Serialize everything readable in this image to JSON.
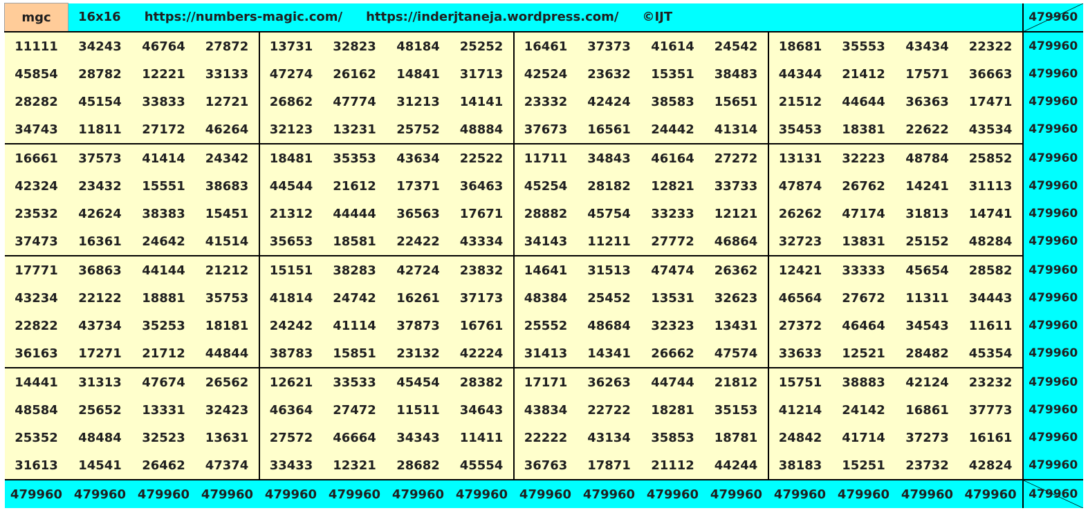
{
  "header": {
    "label": "mgc",
    "order": "16x16",
    "site1": "https://numbers-magic.com/",
    "site2": "https://inderjtaneja.wordpress.com/",
    "copyright": "©IJT",
    "corner_sum": "479960"
  },
  "grid": [
    [
      "11111",
      "34243",
      "46764",
      "27872",
      "13731",
      "32823",
      "48184",
      "25252",
      "16461",
      "37373",
      "41614",
      "24542",
      "18681",
      "35553",
      "43434",
      "22322"
    ],
    [
      "45854",
      "28782",
      "12221",
      "33133",
      "47274",
      "26162",
      "14841",
      "31713",
      "42524",
      "23632",
      "15351",
      "38483",
      "44344",
      "21412",
      "17571",
      "36663"
    ],
    [
      "28282",
      "45154",
      "33833",
      "12721",
      "26862",
      "47774",
      "31213",
      "14141",
      "23332",
      "42424",
      "38583",
      "15651",
      "21512",
      "44644",
      "36363",
      "17471"
    ],
    [
      "34743",
      "11811",
      "27172",
      "46264",
      "32123",
      "13231",
      "25752",
      "48884",
      "37673",
      "16561",
      "24442",
      "41314",
      "35453",
      "18381",
      "22622",
      "43534"
    ],
    [
      "16661",
      "37573",
      "41414",
      "24342",
      "18481",
      "35353",
      "43634",
      "22522",
      "11711",
      "34843",
      "46164",
      "27272",
      "13131",
      "32223",
      "48784",
      "25852"
    ],
    [
      "42324",
      "23432",
      "15551",
      "38683",
      "44544",
      "21612",
      "17371",
      "36463",
      "45254",
      "28182",
      "12821",
      "33733",
      "47874",
      "26762",
      "14241",
      "31113"
    ],
    [
      "23532",
      "42624",
      "38383",
      "15451",
      "21312",
      "44444",
      "36563",
      "17671",
      "28882",
      "45754",
      "33233",
      "12121",
      "26262",
      "47174",
      "31813",
      "14741"
    ],
    [
      "37473",
      "16361",
      "24642",
      "41514",
      "35653",
      "18581",
      "22422",
      "43334",
      "34143",
      "11211",
      "27772",
      "46864",
      "32723",
      "13831",
      "25152",
      "48284"
    ],
    [
      "17771",
      "36863",
      "44144",
      "21212",
      "15151",
      "38283",
      "42724",
      "23832",
      "14641",
      "31513",
      "47474",
      "26362",
      "12421",
      "33333",
      "45654",
      "28582"
    ],
    [
      "43234",
      "22122",
      "18881",
      "35753",
      "41814",
      "24742",
      "16261",
      "37173",
      "48384",
      "25452",
      "13531",
      "32623",
      "46564",
      "27672",
      "11311",
      "34443"
    ],
    [
      "22822",
      "43734",
      "35253",
      "18181",
      "24242",
      "41114",
      "37873",
      "16761",
      "25552",
      "48684",
      "32323",
      "13431",
      "27372",
      "46464",
      "34543",
      "11611"
    ],
    [
      "36163",
      "17271",
      "21712",
      "44844",
      "38783",
      "15851",
      "23132",
      "42224",
      "31413",
      "14341",
      "26662",
      "47574",
      "33633",
      "12521",
      "28482",
      "45354"
    ],
    [
      "14441",
      "31313",
      "47674",
      "26562",
      "12621",
      "33533",
      "45454",
      "28382",
      "17171",
      "36263",
      "44744",
      "21812",
      "15751",
      "38883",
      "42124",
      "23232"
    ],
    [
      "48584",
      "25652",
      "13331",
      "32423",
      "46364",
      "27472",
      "11511",
      "34643",
      "43834",
      "22722",
      "18281",
      "35153",
      "41214",
      "24142",
      "16861",
      "37773"
    ],
    [
      "25352",
      "48484",
      "32523",
      "13631",
      "27572",
      "46664",
      "34343",
      "11411",
      "22222",
      "43134",
      "35853",
      "18781",
      "24842",
      "41714",
      "37273",
      "16161"
    ],
    [
      "31613",
      "14541",
      "26462",
      "47374",
      "33433",
      "12321",
      "28682",
      "45554",
      "36763",
      "17871",
      "21112",
      "44244",
      "38183",
      "15251",
      "23732",
      "42824"
    ]
  ],
  "row_sums": [
    "479960",
    "479960",
    "479960",
    "479960",
    "479960",
    "479960",
    "479960",
    "479960",
    "479960",
    "479960",
    "479960",
    "479960",
    "479960",
    "479960",
    "479960",
    "479960"
  ],
  "col_sums": [
    "479960",
    "479960",
    "479960",
    "479960",
    "479960",
    "479960",
    "479960",
    "479960",
    "479960",
    "479960",
    "479960",
    "479960",
    "479960",
    "479960",
    "479960",
    "479960"
  ],
  "bottom_corner_sum": "479960"
}
